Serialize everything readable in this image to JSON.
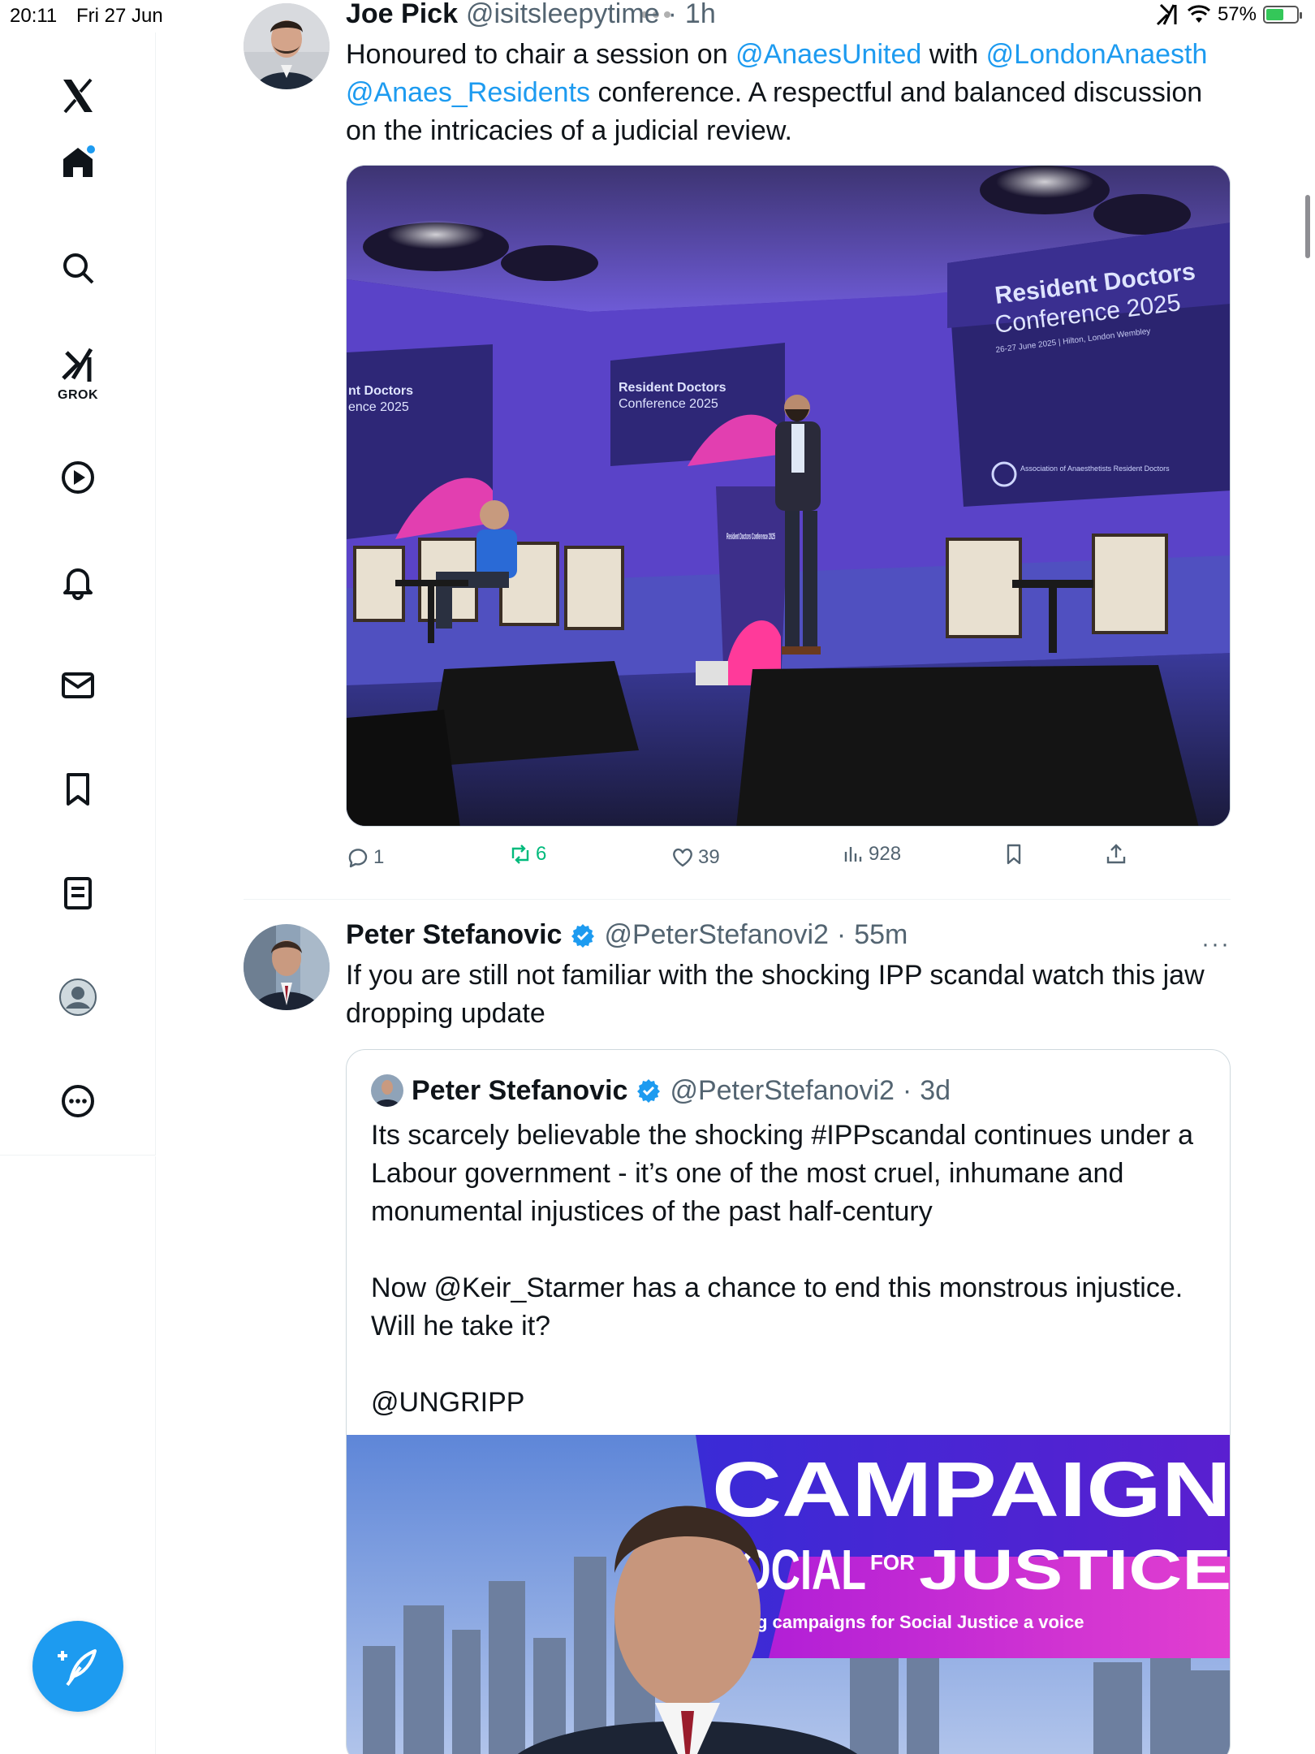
{
  "status_bar": {
    "time": "20:11",
    "date": "Fri 27 Jun",
    "battery": "57%",
    "battery_level": 0.57
  },
  "sidebar": {
    "items": [
      {
        "name": "home",
        "icon": "home-icon"
      },
      {
        "name": "search",
        "icon": "search-icon"
      },
      {
        "name": "grok",
        "icon": "grok-icon",
        "label": "GROK"
      },
      {
        "name": "videos",
        "icon": "play-icon"
      },
      {
        "name": "notifications",
        "icon": "bell-icon"
      },
      {
        "name": "messages",
        "icon": "mail-icon"
      },
      {
        "name": "bookmarks",
        "icon": "bookmark-icon"
      },
      {
        "name": "lists",
        "icon": "list-icon"
      },
      {
        "name": "profile",
        "icon": "profile-icon"
      },
      {
        "name": "more",
        "icon": "more-icon"
      }
    ],
    "compose": "compose-icon"
  },
  "tweets": [
    {
      "name": "Joe Pick",
      "handle": "@isitsleepytime",
      "time": "1h",
      "text_parts": [
        "Honoured to chair a session on ",
        "@AnaesUnited",
        " with ",
        "@LondonAnaesth",
        "@Anaes_Residents",
        " conference. A respectful and balanced discussion on the intricacies of a judicial review."
      ],
      "media": {
        "screen_large_title": "Resident Doctors",
        "screen_large_subtitle": "Conference 2025",
        "screen_large_caption": "26-27 June 2025 | Hilton, London Wembley",
        "screen_mid_title": "Resident Doctors",
        "screen_mid_subtitle": "Conference 2025",
        "screen_left_title": "nt Doctors",
        "screen_left_subtitle": "ence 2025",
        "lectern_text": "Resident Doctors Conference 2025",
        "org_text": "Association of Anaesthetists Resident Doctors"
      },
      "replies": "1",
      "reposts": "6",
      "likes": "39",
      "views": "928"
    },
    {
      "name": "Peter Stefanovic",
      "handle": "@PeterStefanovi2",
      "time": "55m",
      "text": "If you are still not familiar with the shocking IPP scandal watch this jaw dropping update",
      "quote": {
        "name": "Peter Stefanovic",
        "handle": "@PeterStefanovi2",
        "time": "3d",
        "text": "Its scarcely believable the shocking #IPPscandal continues under a Labour government - it’s one of the most cruel, inhumane and monumental injustices of the past half-century\n\nNow @Keir_Starmer has a chance to end this monstrous injustice. Will he take it?\n\n@UNGRIPP",
        "media": {
          "banner_line1": "CAMPAIGN",
          "banner_line2a": "SOCIAL",
          "banner_for": "FOR",
          "banner_line2b": "JUSTICE",
          "banner_tagline": "Giving campaigns for Social Justice a voice"
        }
      }
    }
  ],
  "colors": {
    "accent": "#1d9bf0",
    "repost_green": "#00ba7c",
    "text": "#0f1419",
    "muted": "#536471"
  }
}
